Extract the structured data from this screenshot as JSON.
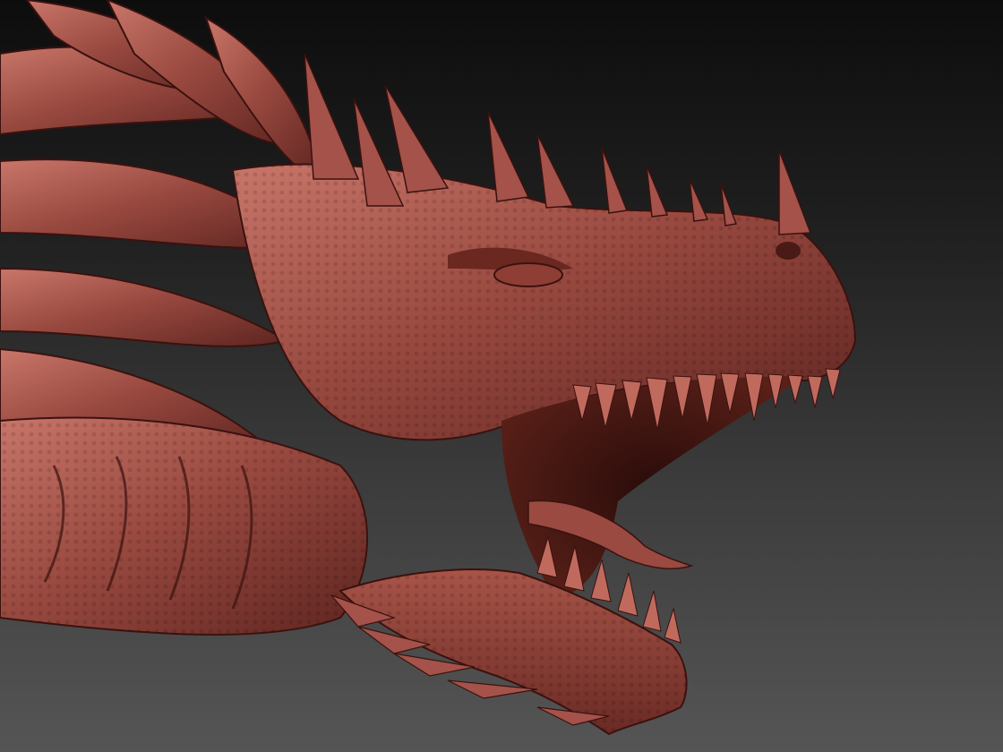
{
  "scene": {
    "subject": "dragon-head-sculpt",
    "colors": {
      "background_top": "#0d0d0d",
      "background_bottom": "#555555",
      "clay_base": "#8a3a32",
      "clay_light": "#b05a4e",
      "clay_highlight": "#c9766a",
      "clay_shadow": "#4a1a16",
      "clay_deep": "#2a0c0a"
    }
  }
}
